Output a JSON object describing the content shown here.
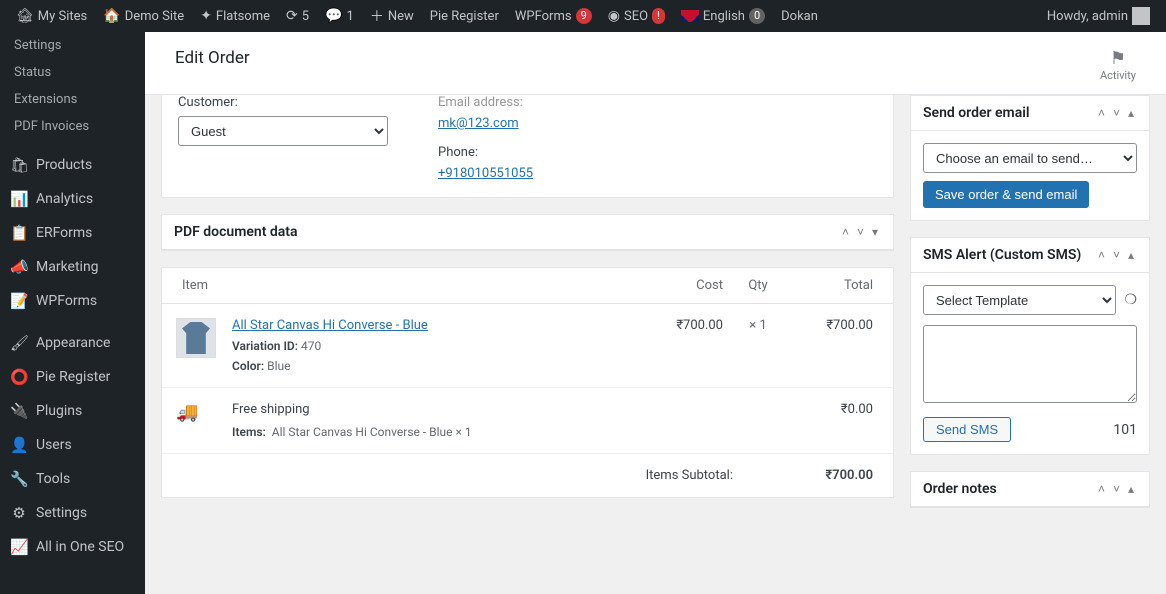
{
  "adminbar": {
    "my_sites": "My Sites",
    "site_name": "Demo Site",
    "theme": "Flatsome",
    "updates_count": "5",
    "comments_count": "1",
    "new": "New",
    "pie_register": "Pie Register",
    "wpforms": "WPForms",
    "wpforms_badge": "9",
    "seo": "SEO",
    "seo_badge": "!",
    "language": "English",
    "language_badge": "0",
    "dokan": "Dokan",
    "howdy": "Howdy, admin"
  },
  "sidebar": {
    "sub_items": [
      "Settings",
      "Status",
      "Extensions",
      "PDF Invoices"
    ],
    "items": [
      {
        "icon": "🛍",
        "label": "Products"
      },
      {
        "icon": "📊",
        "label": "Analytics"
      },
      {
        "icon": "📋",
        "label": "ERForms"
      },
      {
        "icon": "📣",
        "label": "Marketing"
      },
      {
        "icon": "📝",
        "label": "WPForms"
      }
    ],
    "items2": [
      {
        "icon": "🖌",
        "label": "Appearance"
      },
      {
        "icon": "⭕",
        "label": "Pie Register"
      },
      {
        "icon": "🔌",
        "label": "Plugins"
      },
      {
        "icon": "👤",
        "label": "Users"
      },
      {
        "icon": "🔧",
        "label": "Tools"
      },
      {
        "icon": "⚙",
        "label": "Settings"
      },
      {
        "icon": "📈",
        "label": "All in One SEO"
      }
    ]
  },
  "page": {
    "title": "Edit Order",
    "activity": "Activity"
  },
  "order": {
    "customer_label": "Customer:",
    "customer_value": "Guest",
    "email_label": "Email address:",
    "email_value": "mk@123.com",
    "phone_label": "Phone:",
    "phone_value": "+918010551055"
  },
  "pdfbox": {
    "title": "PDF document data"
  },
  "items_table": {
    "headers": {
      "item": "Item",
      "cost": "Cost",
      "qty": "Qty",
      "total": "Total"
    },
    "line": {
      "name": "All Star Canvas Hi Converse - Blue",
      "variation_label": "Variation ID:",
      "variation_id": "470",
      "color_label": "Color:",
      "color_value": "Blue",
      "cost": "₹700.00",
      "qty_prefix": "×",
      "qty": "1",
      "total": "₹700.00"
    },
    "shipping": {
      "name": "Free shipping",
      "items_label": "Items:",
      "items_text": "All Star Canvas Hi Converse - Blue × 1",
      "total": "₹0.00"
    },
    "subtotal_label": "Items Subtotal:",
    "subtotal_value": "₹700.00"
  },
  "sidepanels": {
    "send_email": {
      "title": "Send order email",
      "dropdown": "Choose an email to send…",
      "button": "Save order & send email"
    },
    "sms": {
      "title": "SMS Alert (Custom SMS)",
      "template_placeholder": "Select Template",
      "send_button": "Send SMS",
      "count": "101"
    },
    "order_notes": {
      "title": "Order notes"
    }
  }
}
